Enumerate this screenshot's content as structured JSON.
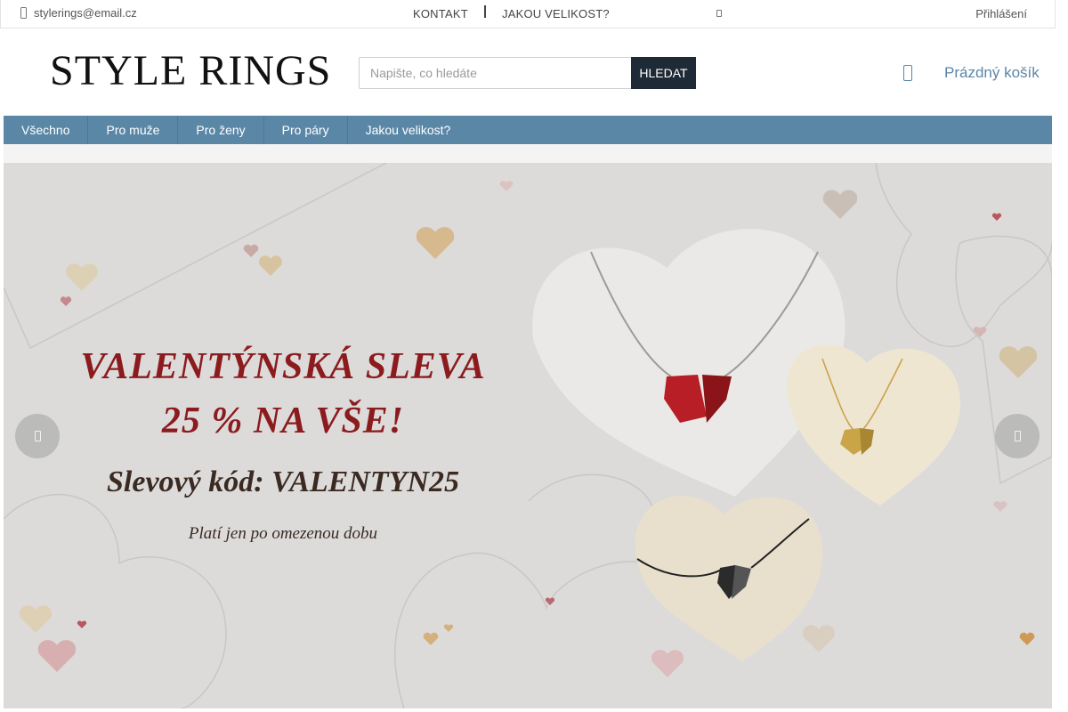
{
  "topbar": {
    "email": "stylerings@email.cz",
    "links": [
      "KONTAKT",
      "JAKOU VELIKOST?"
    ],
    "login": "Přihlášení"
  },
  "header": {
    "logo": "STYLE RINGS",
    "search": {
      "placeholder": "Napište, co hledáte",
      "button": "HLEDAT"
    },
    "cart": "Prázdný košík"
  },
  "categories": [
    "Všechno",
    "Pro muže",
    "Pro ženy",
    "Pro páry",
    "Jakou velikost?"
  ],
  "banner": {
    "line1": "VALENTÝNSKÁ SLEVA",
    "line2": "25 % NA VŠE!",
    "line3": "Slevový kód: VALENTYN25",
    "line4": "Platí jen po omezenou dobu"
  },
  "colors": {
    "nav": "#5b87a7",
    "search_button": "#1e2a36",
    "banner_bg": "#dcdbda",
    "headline_red": "#8c1b1e"
  },
  "icons": [
    "phone-icon",
    "user-icon",
    "cart-icon",
    "chevron-left-icon",
    "chevron-right-icon"
  ]
}
